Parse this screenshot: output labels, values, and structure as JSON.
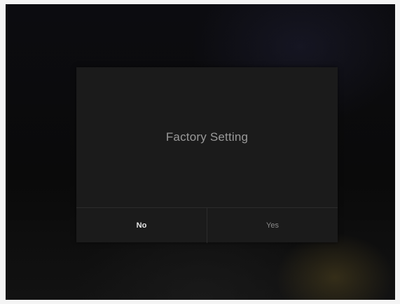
{
  "dialog": {
    "title": "Factory Setting",
    "no_label": "No",
    "yes_label": "Yes"
  },
  "colors": {
    "dialog_background": "#1b1b1b",
    "title_text": "#9a9a9a",
    "selected_button_text": "#e8e8e8",
    "unselected_button_text": "#8a8a8a"
  }
}
